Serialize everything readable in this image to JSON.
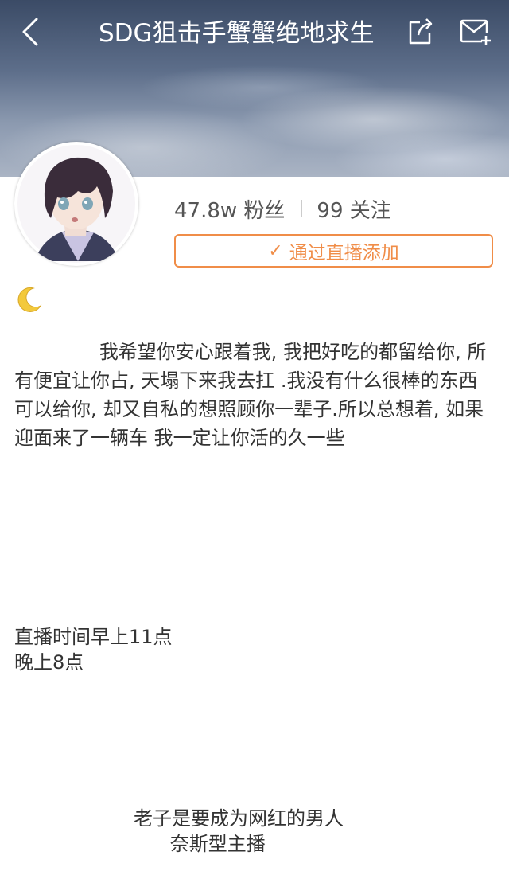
{
  "header": {
    "title": "SDG狙击手蟹蟹绝地求生"
  },
  "icons": {
    "back": "chevron-left-icon",
    "share": "share-icon",
    "message": "mail-plus-icon",
    "emoji": "crescent-moon-emoji"
  },
  "profile": {
    "followers": "47.8w 粉丝",
    "following": "99 关注",
    "add_button_label": "通过直播添加",
    "bio": "              我希望你安心跟着我, 我把好吃的都留给你, 所有便宜让你占, 天塌下来我去扛 .我没有什么很棒的东西可以给你, 却又自私的想照顾你一辈子.所以总想着, 如果迎面来了一辆车 我一定让你活的久一些",
    "live_time": "直播时间早上11点\n晚上8点",
    "motto": "老子是要成为网红的男人\n      奈斯型主播"
  },
  "colors": {
    "accent": "#f08d48",
    "text": "#333333",
    "banner_top": "#3b4b66",
    "banner_bottom": "#aab4c4"
  }
}
